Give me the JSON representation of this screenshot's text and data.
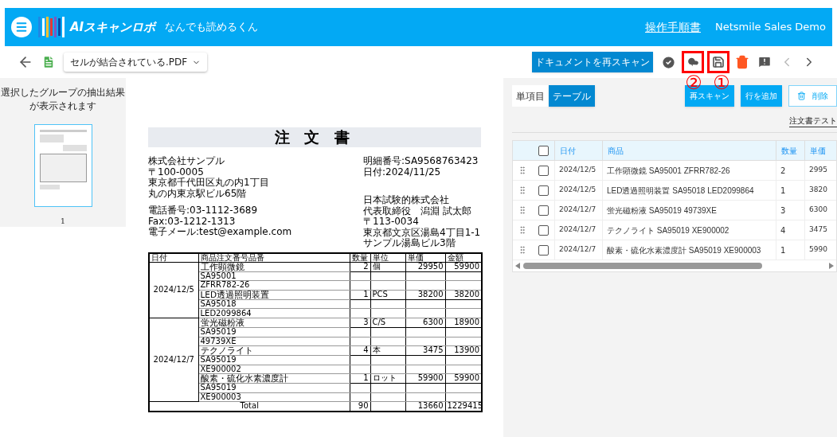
{
  "header": {
    "app_name": "AIスキャンロボ",
    "tagline": "なんでも読めるくん",
    "manual_link": "操作手順書",
    "account": "Netsmile Sales Demo"
  },
  "toolbar": {
    "file_select": "セルが結合されている.PDF",
    "rescan_document": "ドキュメントを再スキャン",
    "annotations": [
      {
        "label": "②"
      },
      {
        "label": "①"
      }
    ]
  },
  "thumbnails": {
    "message": "選択したグループの抽出結果が表示されます",
    "pages": [
      {
        "label": "1",
        "selected": true
      }
    ]
  },
  "document": {
    "title": "注 文 書",
    "left_block": [
      "株式会社サンプル",
      "〒100-0005",
      "東京都千代田区丸の内1丁目",
      "丸の内東京駅ビル65階"
    ],
    "left_contact": [
      "電話番号:03-1112-3689",
      "Fax:03-1212-1313",
      "電子メール:test@example.com"
    ],
    "right_block": [
      "明細番号:SA9568763423",
      "日付:2024/11/25"
    ],
    "right_company": [
      "日本試験的株式会社",
      "代表取締役　潟淵 試太郎",
      "〒113-0034",
      "東京都文京区湯島4丁目1-1",
      "サンプル湯島ビル3階"
    ],
    "table": {
      "columns": [
        "日付",
        "商品注文番号品番",
        "数量",
        "単位",
        "単価",
        "金額"
      ],
      "groups": [
        {
          "date": "2024/12/5",
          "items": [
            {
              "name": "工作顕微鏡",
              "qty": "2",
              "unit": "個",
              "price": "29950",
              "amount": "59900",
              "codes": [
                "SA95001",
                "ZFRR782-26"
              ]
            },
            {
              "name": "LED透過照明装置",
              "qty": "1",
              "unit": "PCS",
              "price": "38200",
              "amount": "38200",
              "codes": [
                "SA95018",
                "LED2099864"
              ]
            }
          ]
        },
        {
          "date": "2024/12/7",
          "items": [
            {
              "name": "蛍光磁粉液",
              "qty": "3",
              "unit": "C/S",
              "price": "6300",
              "amount": "18900",
              "codes": [
                "SA95019",
                "49739XE"
              ]
            },
            {
              "name": "テクノライト",
              "qty": "4",
              "unit": "本",
              "price": "3475",
              "amount": "13900",
              "codes": [
                "SA95019",
                "XE900002"
              ]
            },
            {
              "name": "酸素・硫化水素濃度計",
              "qty": "1",
              "unit": "ロット",
              "price": "59900",
              "amount": "59900",
              "codes": [
                "SA95019",
                "XE900003"
              ]
            }
          ]
        }
      ],
      "total": {
        "label": "Total",
        "qty": "90",
        "price": "13660",
        "amount": "1229415"
      }
    }
  },
  "result_panel": {
    "tabs": [
      {
        "label": "単項目",
        "selected": false
      },
      {
        "label": "テーブル",
        "selected": true
      }
    ],
    "buttons": [
      {
        "label": "再スキャン",
        "kind": "filled"
      },
      {
        "label": "行を追加",
        "kind": "filled"
      },
      {
        "label": "削除",
        "kind": "outlined"
      }
    ],
    "table_name": "注文書テスト",
    "table": {
      "header_checked": false,
      "columns": [
        "日付",
        "商品",
        "数量",
        "単価"
      ],
      "rows": [
        {
          "checked": false,
          "cells": [
            "2024/12/5",
            "工作顕微鏡 SA95001 ZFRR782-26",
            "2",
            "2995"
          ]
        },
        {
          "checked": false,
          "cells": [
            "2024/12/5",
            "LED透過照明装置 SA95018 LED2099864",
            "1",
            "3820"
          ]
        },
        {
          "checked": false,
          "cells": [
            "2024/12/7",
            "蛍光磁粉液 SA95019 49739XE",
            "3",
            "6300"
          ]
        },
        {
          "checked": false,
          "cells": [
            "2024/12/7",
            "テクノライト SA95019 XE900002",
            "4",
            "3475"
          ]
        },
        {
          "checked": false,
          "cells": [
            "2024/12/7",
            "酸素・硫化水素濃度計 SA95019 XE900003",
            "1",
            "5990"
          ]
        }
      ]
    }
  }
}
